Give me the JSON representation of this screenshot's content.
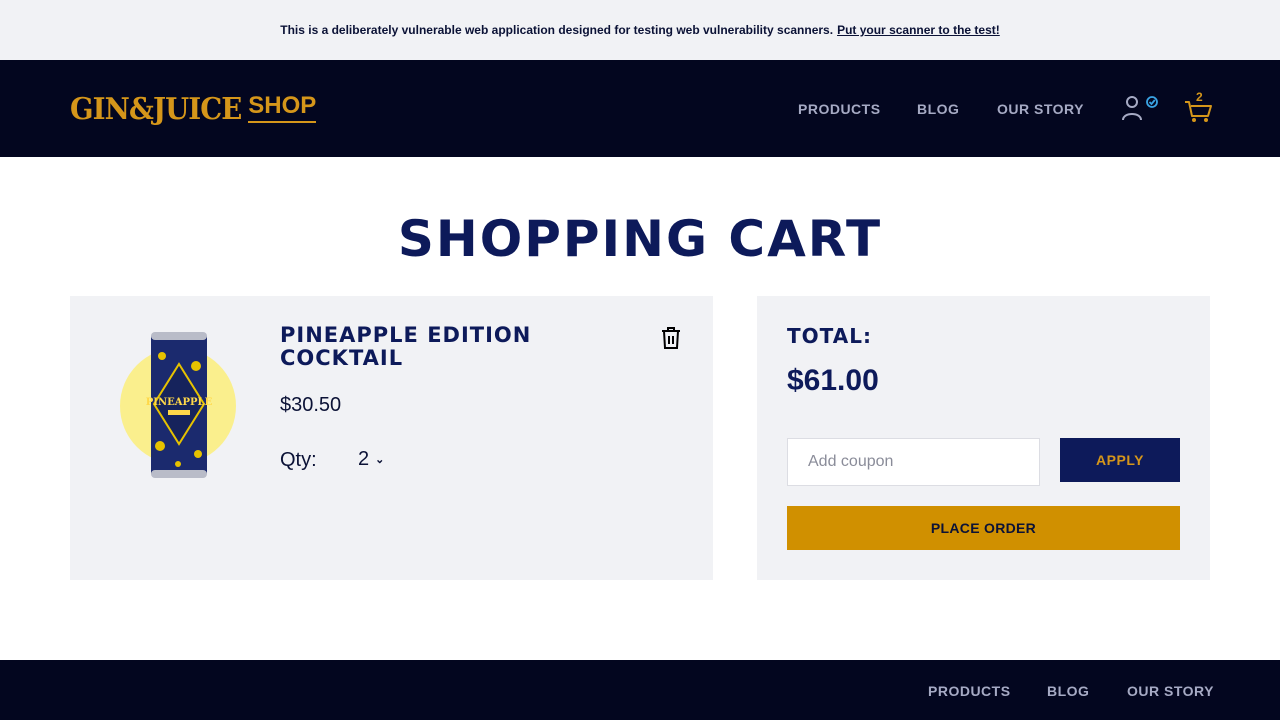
{
  "banner": {
    "text": "This is a deliberately vulnerable web application designed for testing web vulnerability scanners.",
    "link": "Put your scanner to the test!"
  },
  "header": {
    "logo_main": "GIN&JUICE",
    "logo_shop": "SHOP",
    "nav": [
      "PRODUCTS",
      "BLOG",
      "OUR STORY"
    ],
    "cart_count": "2",
    "icons": {
      "user": "user-icon",
      "verified": "check-circle-icon",
      "cart": "cart-icon"
    }
  },
  "page": {
    "title": "SHOPPING CART"
  },
  "cart": {
    "item": {
      "name": "PINEAPPLE EDITION COCKTAIL",
      "price": "$30.50",
      "qty_label": "Qty:",
      "qty_value": "2",
      "image_label": "PINEAPPLE"
    }
  },
  "summary": {
    "total_label": "TOTAL:",
    "total_value": "$61.00",
    "coupon_placeholder": "Add coupon",
    "apply_label": "APPLY",
    "order_label": "PLACE ORDER"
  },
  "footer": {
    "nav": [
      "PRODUCTS",
      "BLOG",
      "OUR STORY"
    ]
  },
  "colors": {
    "navy": "#03061f",
    "title_navy": "#0d1a5a",
    "gold": "#d5961a",
    "order_gold": "#d09000",
    "panel_bg": "#f1f2f5",
    "verified_blue": "#3aa3e3"
  }
}
